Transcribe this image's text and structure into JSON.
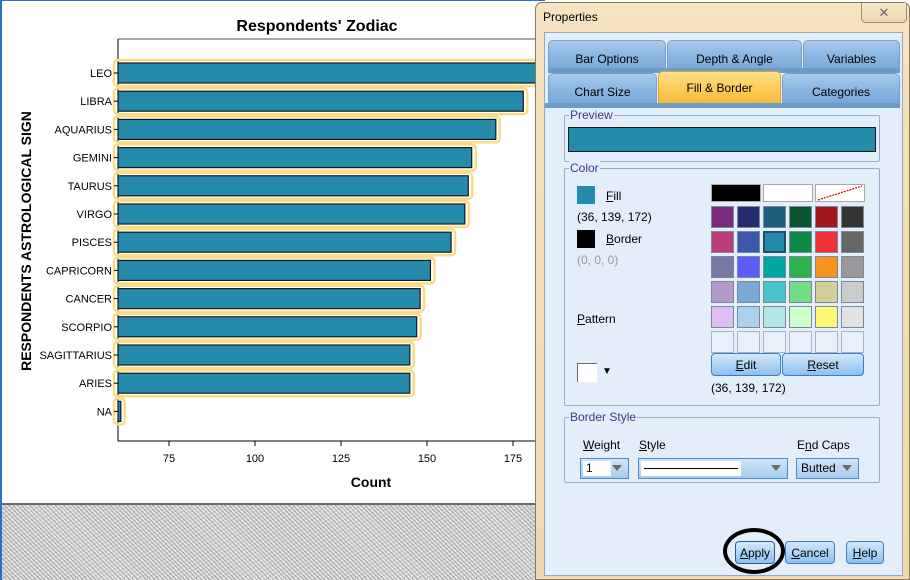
{
  "chart_data": {
    "type": "bar",
    "orientation": "horizontal",
    "title": "Respondents' Zodiac",
    "xlabel": "Count",
    "ylabel": "RESPONDENTS ASTROLOGICAL SIGN",
    "categories": [
      "LEO",
      "LIBRA",
      "AQUARIUS",
      "GEMINI",
      "TAURUS",
      "VIRGO",
      "PISCES",
      "CAPRICORN",
      "CANCER",
      "SCORPIO",
      "SAGITTARIUS",
      "ARIES",
      "NA"
    ],
    "values": [
      184,
      178,
      170,
      163,
      162,
      161,
      157,
      151,
      148,
      147,
      145,
      145,
      61
    ],
    "xlim": [
      60,
      185
    ],
    "xticks": [
      75,
      100,
      125,
      150,
      175
    ],
    "bar_color": "#248bac",
    "bar_border_color": "#1a1a1a",
    "selection_outline_color": "#f9dc86",
    "grid": false,
    "legend": "none"
  },
  "dialog": {
    "title": "Properties",
    "close_glyph": "✕",
    "tabs_row1": [
      {
        "label": "Bar Options",
        "active": false
      },
      {
        "label": "Depth & Angle",
        "active": false
      },
      {
        "label": "Variables",
        "active": false
      }
    ],
    "tabs_row2": [
      {
        "label": "Chart Size",
        "active": false
      },
      {
        "label": "Fill & Border",
        "active": true
      },
      {
        "label": "Categories",
        "active": false
      }
    ],
    "preview": {
      "label": "Preview",
      "color": "#248bac"
    },
    "color": {
      "label": "Color",
      "fill_label_key": "F",
      "fill_label_rest": "ill",
      "fill_color": "#248bac",
      "fill_rgb": "(36, 139, 172)",
      "border_label_key": "B",
      "border_label_rest": "order",
      "border_color": "#000000",
      "border_rgb": "(0, 0, 0)",
      "pattern_label_key": "P",
      "pattern_label_rest": "attern",
      "pattern_arrow": "▼",
      "palette_top": [
        "#000000",
        "#ffffff",
        "none"
      ],
      "palette": [
        [
          "#7a2a7c",
          "#272a6e",
          "#1d5d79",
          "#0a5430",
          "#a0161b",
          "#333333"
        ],
        [
          "#b83d78",
          "#3d58aa",
          "#248bac",
          "#0e8a48",
          "#ef3238",
          "#666666"
        ],
        [
          "#7878a6",
          "#5c5cfc",
          "#00a6a2",
          "#2db34a",
          "#f7941e",
          "#999999"
        ],
        [
          "#b59ac9",
          "#7aa8d6",
          "#48c4c8",
          "#70dc84",
          "#d2cf99",
          "#cccccc"
        ],
        [
          "#e0bdf4",
          "#acd0ee",
          "#b3e6e6",
          "#ccffcc",
          "#fcf873",
          "#e2e2e2"
        ],
        [
          "",
          "",
          "",
          "",
          "",
          ""
        ]
      ],
      "selected_swatch": "#248bac",
      "edit_key": "E",
      "edit_rest": "dit",
      "reset_key": "R",
      "reset_rest": "eset",
      "selected_rgb": "(36, 139, 172)"
    },
    "border_style": {
      "label": "Border Style",
      "weight_key": "W",
      "weight_rest": "eight",
      "weight_value": "1",
      "style_key": "S",
      "style_rest": "tyle",
      "style_value": "solid",
      "endcaps_pre": "E",
      "endcaps_key": "n",
      "endcaps_rest": "d Caps",
      "endcaps_value": "Butted"
    },
    "buttons": {
      "apply_key": "A",
      "apply_rest": "pply",
      "cancel_key": "C",
      "cancel_rest": "ancel",
      "help_key": "H",
      "help_rest": "elp"
    }
  }
}
